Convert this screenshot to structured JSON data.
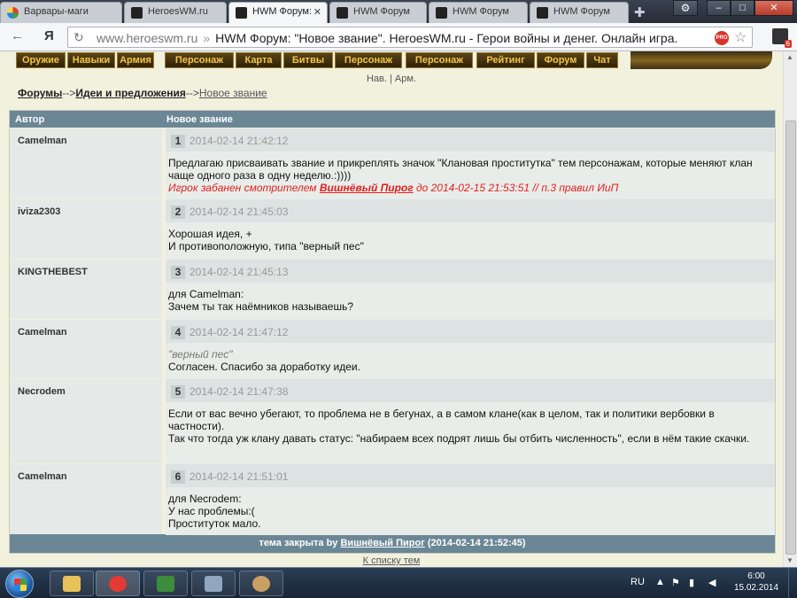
{
  "browser": {
    "tabs": [
      {
        "label": "Варвары-маги",
        "icon": "apps-favicon"
      },
      {
        "label": "HeroesWM.ru",
        "icon": "hwm-favicon"
      },
      {
        "label": "HWM Форум:",
        "icon": "hwm-favicon",
        "active": true
      },
      {
        "label": "HWM Форум",
        "icon": "hwm-favicon"
      },
      {
        "label": "HWM Форум",
        "icon": "hwm-favicon"
      },
      {
        "label": "HWM Форум",
        "icon": "hwm-favicon"
      }
    ],
    "close_glyph": "✕",
    "url_domain": "www.heroeswm.ru",
    "url_separator": "»",
    "page_title": "HWM Форум: \"Новое звание\". HeroesWM.ru - Герои войны и денег. Онлайн игра.",
    "pro_badge": "PRO",
    "extension_badge": "6"
  },
  "menu": {
    "items": [
      "Оружие",
      "Навыки",
      "Армия",
      "Персонаж",
      "Карта",
      "Битвы",
      "Персонаж",
      "Персонаж",
      "Рейтинг",
      "Форум",
      "Чат"
    ],
    "subnav": "Нав. | Арм."
  },
  "breadcrumb": {
    "forums": "Форумы",
    "sep1": "-->",
    "section": "Идеи и предложения",
    "sep2": "-->",
    "topic": "Новое звание"
  },
  "table": {
    "col_author": "Автор",
    "col_topic": "Новое звание",
    "posts": [
      {
        "author": "Camelman",
        "num": "1",
        "date": "2014-02-14 21:42:12",
        "lines": [
          "Предлагаю присваивать звание и прикреплять значок \"Клановая проститутка\" тем персонажам, которые меняют клан чаще одного раза в одну неделю.:))))"
        ],
        "ban_prefix": "Игрок забанен смотрителем ",
        "ban_moderator": "Вишнёвый Пирог",
        "ban_suffix": " до 2014-02-15 21:53:51 // п.3 правил ИиП"
      },
      {
        "author": "iviza2303",
        "num": "2",
        "date": "2014-02-14 21:45:03",
        "lines": [
          "Хорошая идея, +",
          "И противоположную, типа \"верный пес\""
        ]
      },
      {
        "author": "KINGTHEBEST",
        "num": "3",
        "date": "2014-02-14 21:45:13",
        "lines": [
          "для Camelman:",
          "Зачем ты так наёмников называешь?"
        ]
      },
      {
        "author": "Camelman",
        "num": "4",
        "date": "2014-02-14 21:47:12",
        "quote": "\"верный пес\"",
        "lines": [
          "Согласен. Спасибо за доработку идеи."
        ]
      },
      {
        "author": "Necrodem",
        "num": "5",
        "date": "2014-02-14 21:47:38",
        "lines": [
          "Если от вас вечно убегают, то проблема не в бегунах, а в самом клане(как в целом, так и политики вербовки в частности).",
          "Так что тогда уж клану давать статус: \"набираем всех подрят лишь бы отбить численность\", если в нём такие скачки."
        ]
      },
      {
        "author": "Camelman",
        "num": "6",
        "date": "2014-02-14 21:51:01",
        "lines": [
          "для Necrodem:",
          "У нас проблемы:(",
          "Проституток мало."
        ]
      }
    ],
    "footer_prefix": "тема закрыта by ",
    "footer_user": "Вишнёвый Пирог",
    "footer_suffix": " (2014-02-14 21:52:45)"
  },
  "back_link": "К списку тем",
  "taskbar": {
    "apps": [
      "explorer-icon",
      "yandex-icon",
      "media-icon",
      "calculator-icon",
      "paint-icon"
    ],
    "lang": "RU",
    "time": "6:00",
    "date": "15.02.2014"
  }
}
